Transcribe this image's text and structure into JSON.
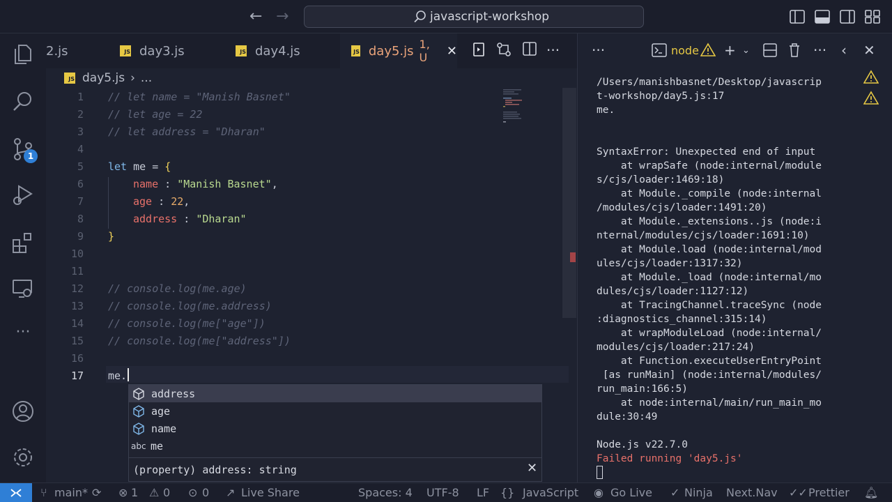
{
  "window": {
    "search_label": "javascript-workshop"
  },
  "activity_bar": {
    "scm_badge": "1"
  },
  "tabs": [
    {
      "label": "2.js"
    },
    {
      "label": "day3.js"
    },
    {
      "label": "day4.js"
    },
    {
      "label": "day5.js",
      "status": "1, U",
      "active": true
    }
  ],
  "breadcrumb": {
    "file": "day5.js",
    "separator": "›",
    "more": "..."
  },
  "editor": {
    "lines": [
      "1",
      "2",
      "3",
      "4",
      "5",
      "6",
      "7",
      "8",
      "9",
      "10",
      "11",
      "12",
      "13",
      "14",
      "15",
      "16",
      "17"
    ],
    "code": {
      "l1": "// let name = \"Manish Basnet\"",
      "l2": "// let age = 22",
      "l3": "// let address = \"Dharan\"",
      "l5_kw": "let",
      "l5_rest": " me = ",
      "brace_open": "{",
      "l6_prop": "name",
      "l6_colon": " : ",
      "l6_val": "\"Manish Basnet\"",
      "l7_prop": "age",
      "l7_colon": " : ",
      "l7_val": "22",
      "l8_prop": "address",
      "l8_colon": " : ",
      "l8_val": "\"Dharan\"",
      "comma": ",",
      "brace_close": "}",
      "l12": "// console.log(me.age)",
      "l13": "// console.log(me.address)",
      "l14": "// console.log(me[\"age\"])",
      "l15": "// console.log(me[\"address\"])",
      "l17": "me."
    }
  },
  "suggest": {
    "items": [
      {
        "label": "address",
        "kind": "property"
      },
      {
        "label": "age",
        "kind": "property"
      },
      {
        "label": "name",
        "kind": "property"
      },
      {
        "label": "me",
        "kind": "text",
        "kind_label": "abc"
      }
    ],
    "detail": "(property) address: string"
  },
  "panel": {
    "terminal_name": "node",
    "lines": [
      "/Users/manishbasnet/Desktop/javascrip",
      "t-workshop/day5.js:17",
      "me.",
      "",
      "",
      "SyntaxError: Unexpected end of input",
      "    at wrapSafe (node:internal/module",
      "s/cjs/loader:1469:18)",
      "    at Module._compile (node:internal",
      "/modules/cjs/loader:1491:20)",
      "    at Module._extensions..js (node:i",
      "nternal/modules/cjs/loader:1691:10)",
      "    at Module.load (node:internal/mod",
      "ules/cjs/loader:1317:32)",
      "    at Module._load (node:internal/mo",
      "dules/cjs/loader:1127:12)",
      "    at TracingChannel.traceSync (node",
      ":diagnostics_channel:315:14)",
      "    at wrapModuleLoad (node:internal/",
      "modules/cjs/loader:217:24)",
      "    at Function.executeUserEntryPoint",
      " [as runMain] (node:internal/modules/",
      "run_main:166:5)",
      "    at node:internal/main/run_main_mo",
      "dule:30:49",
      "",
      "Node.js v22.7.0"
    ],
    "error_line": "Failed running 'day5.js'"
  },
  "status_bar": {
    "branch": "main*",
    "problems_errors": "1",
    "problems_warnings": "0",
    "ports": "0",
    "live_share": "Live Share",
    "spaces": "Spaces: 4",
    "encoding": "UTF-8",
    "eol": "LF",
    "language": "JavaScript",
    "go_live": "Go Live",
    "ninja": "Ninja",
    "next_nav": "Next.Nav",
    "prettier": "Prettier"
  }
}
